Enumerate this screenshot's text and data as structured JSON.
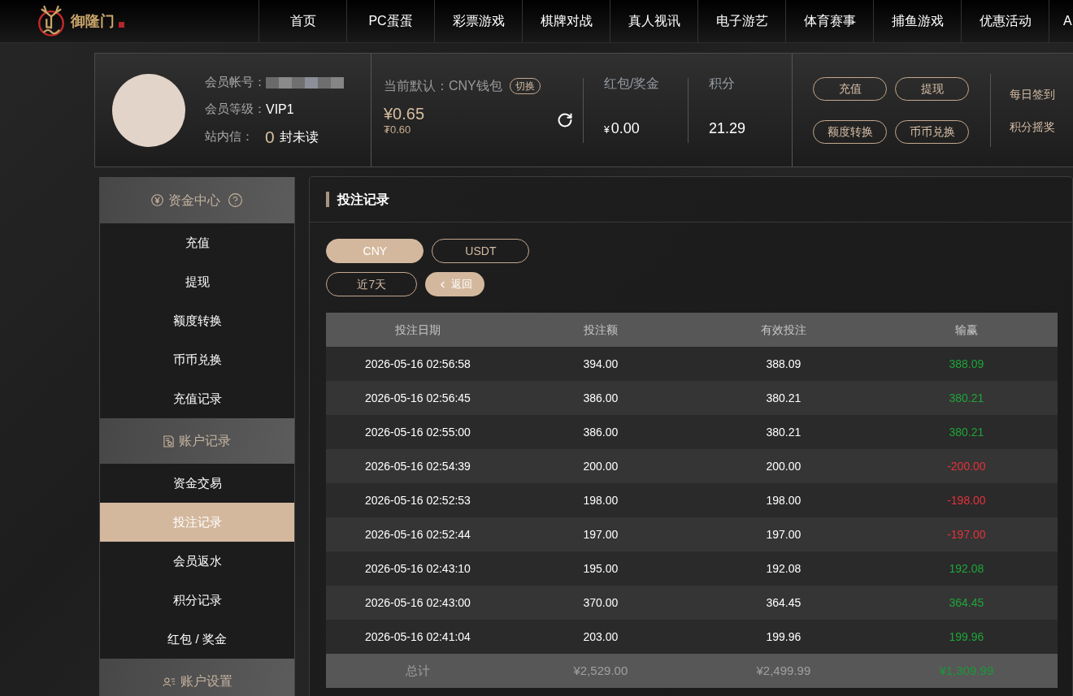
{
  "logo": {
    "name": "御隆门"
  },
  "nav": [
    "首页",
    "PC蛋蛋",
    "彩票游戏",
    "棋牌对战",
    "真人视讯",
    "电子游艺",
    "体育赛事",
    "捕鱼游戏",
    "优惠活动",
    "A"
  ],
  "profile": {
    "account_label": "会员帐号：",
    "level_label": "会员等级：",
    "level": "VIP1",
    "inbox_label": "站内信：",
    "unread_count": "0",
    "unread_text": "封未读"
  },
  "wallet": {
    "label": "当前默认：CNY钱包",
    "switch_button": "切换",
    "balance": "¥0.65",
    "usdt_balance": "₮0.60"
  },
  "stats": [
    {
      "label": "红包/奖金",
      "currency": "¥",
      "value": "0.00"
    },
    {
      "label": "积分",
      "value": "21.29"
    }
  ],
  "actions": [
    "充值",
    "提现",
    "额度转换",
    "币币兑换"
  ],
  "links": [
    "每日签到",
    "积分摇奖"
  ],
  "sidebar": {
    "sections": [
      {
        "kind": "funds",
        "title": "资金中心",
        "help": true,
        "items": [
          {
            "label": "充值",
            "selected": false
          },
          {
            "label": "提现",
            "selected": false
          },
          {
            "label": "额度转换",
            "selected": false
          },
          {
            "label": "币币兑换",
            "selected": false
          },
          {
            "label": "充值记录",
            "selected": false
          }
        ]
      },
      {
        "kind": "records",
        "title": "账户记录",
        "help": false,
        "items": [
          {
            "label": "资金交易",
            "selected": false
          },
          {
            "label": "投注记录",
            "selected": true
          },
          {
            "label": "会员返水",
            "selected": false
          },
          {
            "label": "积分记录",
            "selected": false
          },
          {
            "label": "红包 / 奖金",
            "selected": false
          }
        ]
      },
      {
        "kind": "settings",
        "title": "账户设置",
        "help": false
      }
    ]
  },
  "panel": {
    "title": "投注记录",
    "currency_tabs": [
      {
        "label": "CNY",
        "selected": true
      },
      {
        "label": "USDT",
        "selected": false
      }
    ],
    "range_button": "近7天",
    "back_button": "返回"
  },
  "table": {
    "columns": [
      "投注日期",
      "投注额",
      "有效投注",
      "输赢"
    ],
    "rows": [
      {
        "date": "2026-05-16 02:56:58",
        "stake": "394.00",
        "valid": "388.09",
        "result": "388.09",
        "color": "#1fa53a"
      },
      {
        "date": "2026-05-16 02:56:45",
        "stake": "386.00",
        "valid": "380.21",
        "result": "380.21",
        "color": "#1fa53a"
      },
      {
        "date": "2026-05-16 02:55:00",
        "stake": "386.00",
        "valid": "380.21",
        "result": "380.21",
        "color": "#1fa53a"
      },
      {
        "date": "2026-05-16 02:54:39",
        "stake": "200.00",
        "valid": "200.00",
        "result": "-200.00",
        "color": "#e5323a"
      },
      {
        "date": "2026-05-16 02:52:53",
        "stake": "198.00",
        "valid": "198.00",
        "result": "-198.00",
        "color": "#e5323a"
      },
      {
        "date": "2026-05-16 02:52:44",
        "stake": "197.00",
        "valid": "197.00",
        "result": "-197.00",
        "color": "#e5323a"
      },
      {
        "date": "2026-05-16 02:43:10",
        "stake": "195.00",
        "valid": "192.08",
        "result": "192.08",
        "color": "#1fa53a"
      },
      {
        "date": "2026-05-16 02:43:00",
        "stake": "370.00",
        "valid": "364.45",
        "result": "364.45",
        "color": "#1fa53a"
      },
      {
        "date": "2026-05-16 02:41:04",
        "stake": "203.00",
        "valid": "199.96",
        "result": "199.96",
        "color": "#1fa53a"
      }
    ],
    "total": {
      "label": "总计",
      "stake": "¥2,529.00",
      "valid": "¥2,499.99",
      "result": "¥1,309.99"
    }
  }
}
